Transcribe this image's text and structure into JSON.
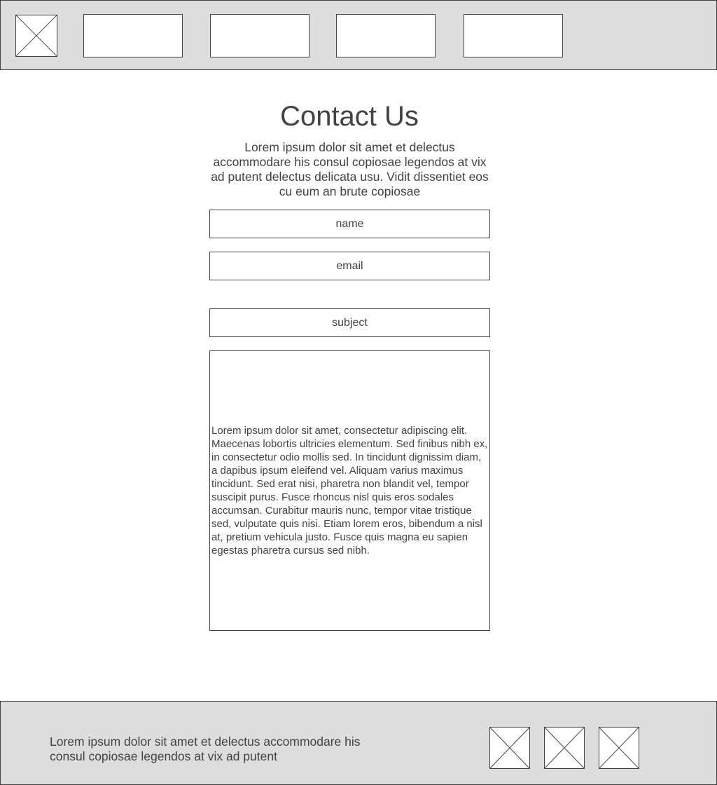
{
  "header": {
    "logo_icon": "image-placeholder-icon",
    "nav_items": [
      "",
      "",
      "",
      ""
    ]
  },
  "main": {
    "title": "Contact Us",
    "intro": "Lorem ipsum dolor sit amet et delectus accommodare his consul copiosae legendos at vix ad putent delectus delicata usu. Vidit dissentiet eos cu eum an brute copiosae",
    "form": {
      "name_placeholder": "name",
      "email_placeholder": "email",
      "subject_placeholder": "subject",
      "message_text": "Lorem ipsum dolor sit amet, consectetur adipiscing elit. Maecenas lobortis ultricies elementum. Sed finibus nibh ex, in consectetur odio mollis sed. In tincidunt dignissim diam, a dapibus ipsum eleifend vel. Aliquam varius maximus tincidunt. Sed erat nisi, pharetra non blandit vel, tempor suscipit purus. Fusce rhoncus nisl quis eros sodales accumsan. Curabitur mauris nunc, tempor vitae tristique sed, vulputate quis nisi. Etiam lorem eros, bibendum a nisl at, pretium vehicula justo. Fusce quis magna eu sapien egestas pharetra cursus sed nibh."
    }
  },
  "footer": {
    "text": "Lorem ipsum dolor sit amet et delectus accommodare his consul copiosae legendos at vix ad putent",
    "social_icons": [
      "image-placeholder-icon",
      "image-placeholder-icon",
      "image-placeholder-icon"
    ]
  },
  "colors": {
    "bar_background": "#dddddd",
    "border": "#424242",
    "text": "#424242",
    "page_background": "#ffffff"
  }
}
